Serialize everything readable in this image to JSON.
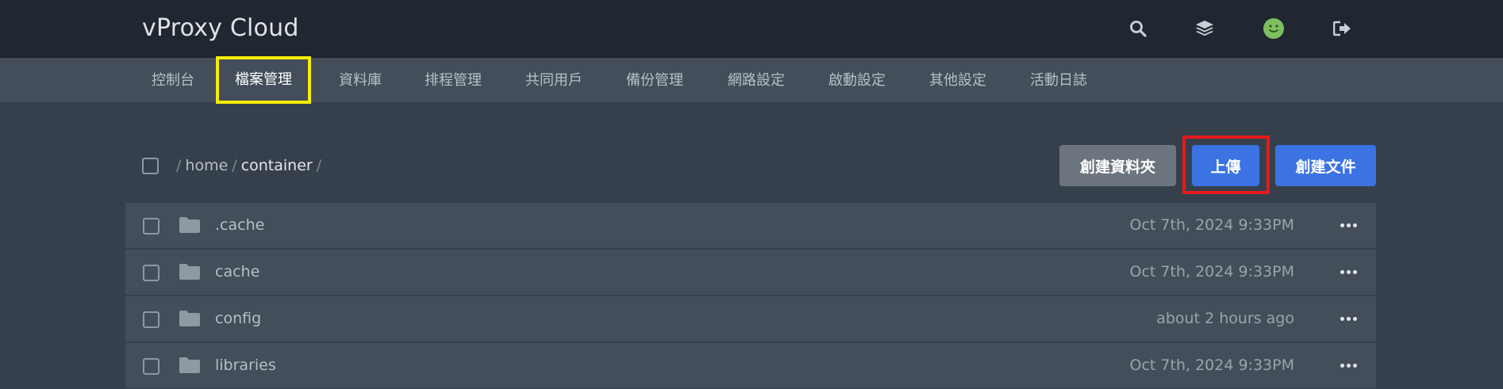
{
  "header": {
    "brand": "vProxy Cloud",
    "icons": [
      "search-icon",
      "layers-icon",
      "avatar-smiley-icon",
      "logout-icon"
    ]
  },
  "nav": {
    "items": [
      {
        "label": "控制台"
      },
      {
        "label": "檔案管理",
        "active": true
      },
      {
        "label": "資料庫"
      },
      {
        "label": "排程管理"
      },
      {
        "label": "共同用戶"
      },
      {
        "label": "備份管理"
      },
      {
        "label": "網路設定"
      },
      {
        "label": "啟動設定"
      },
      {
        "label": "其他設定"
      },
      {
        "label": "活動日誌"
      }
    ]
  },
  "breadcrumb": {
    "root": "/",
    "parts": [
      "home",
      "container"
    ],
    "sep": "/"
  },
  "toolbar": {
    "create_folder_label": "創建資料夾",
    "upload_label": "上傳",
    "create_file_label": "創建文件"
  },
  "files": [
    {
      "name": ".cache",
      "date": "Oct 7th, 2024 9:33PM"
    },
    {
      "name": "cache",
      "date": "Oct 7th, 2024 9:33PM"
    },
    {
      "name": "config",
      "date": "about 2 hours ago"
    },
    {
      "name": "libraries",
      "date": "Oct 7th, 2024 9:33PM"
    }
  ],
  "colors": {
    "header_bg": "#212731",
    "nav_bg": "#434e5a",
    "page_bg": "#36404c",
    "row_bg": "#434e5a",
    "accent_blue": "#3b73e3",
    "button_grey": "#6c757d",
    "active_tab_outline": "#f5ec00",
    "upload_outline": "#e51a1a",
    "avatar_green": "#7cbf5e"
  }
}
